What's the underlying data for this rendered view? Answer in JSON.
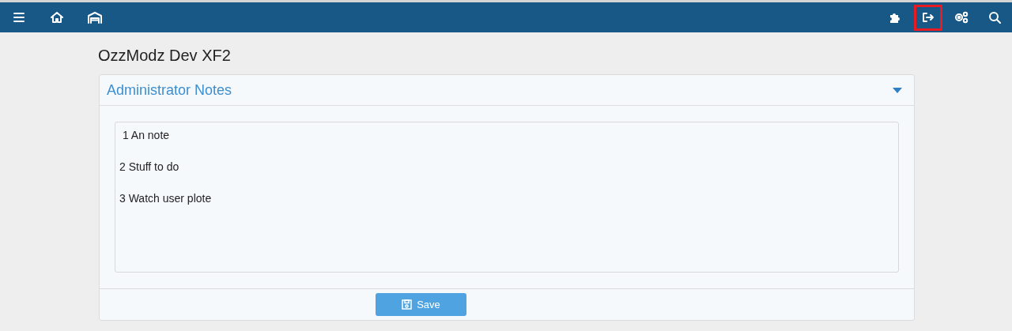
{
  "top_bar": {
    "left_icons": [
      {
        "kind": "menu"
      },
      {
        "kind": "home"
      },
      {
        "kind": "garage"
      }
    ],
    "right_icons": [
      {
        "kind": "puzzle",
        "highlighted": false
      },
      {
        "kind": "logout",
        "highlighted": true
      },
      {
        "kind": "gears",
        "highlighted": false
      },
      {
        "kind": "search",
        "highlighted": false
      }
    ]
  },
  "page_title": "OzzModz Dev XF2",
  "panel": {
    "title": "Administrator Notes",
    "expanded": true,
    "notes_field": {
      "value": " 1 An note\n\n2 Stuff to do\n\n3 Watch user plote"
    },
    "save_button": {
      "label": "Save"
    }
  }
}
